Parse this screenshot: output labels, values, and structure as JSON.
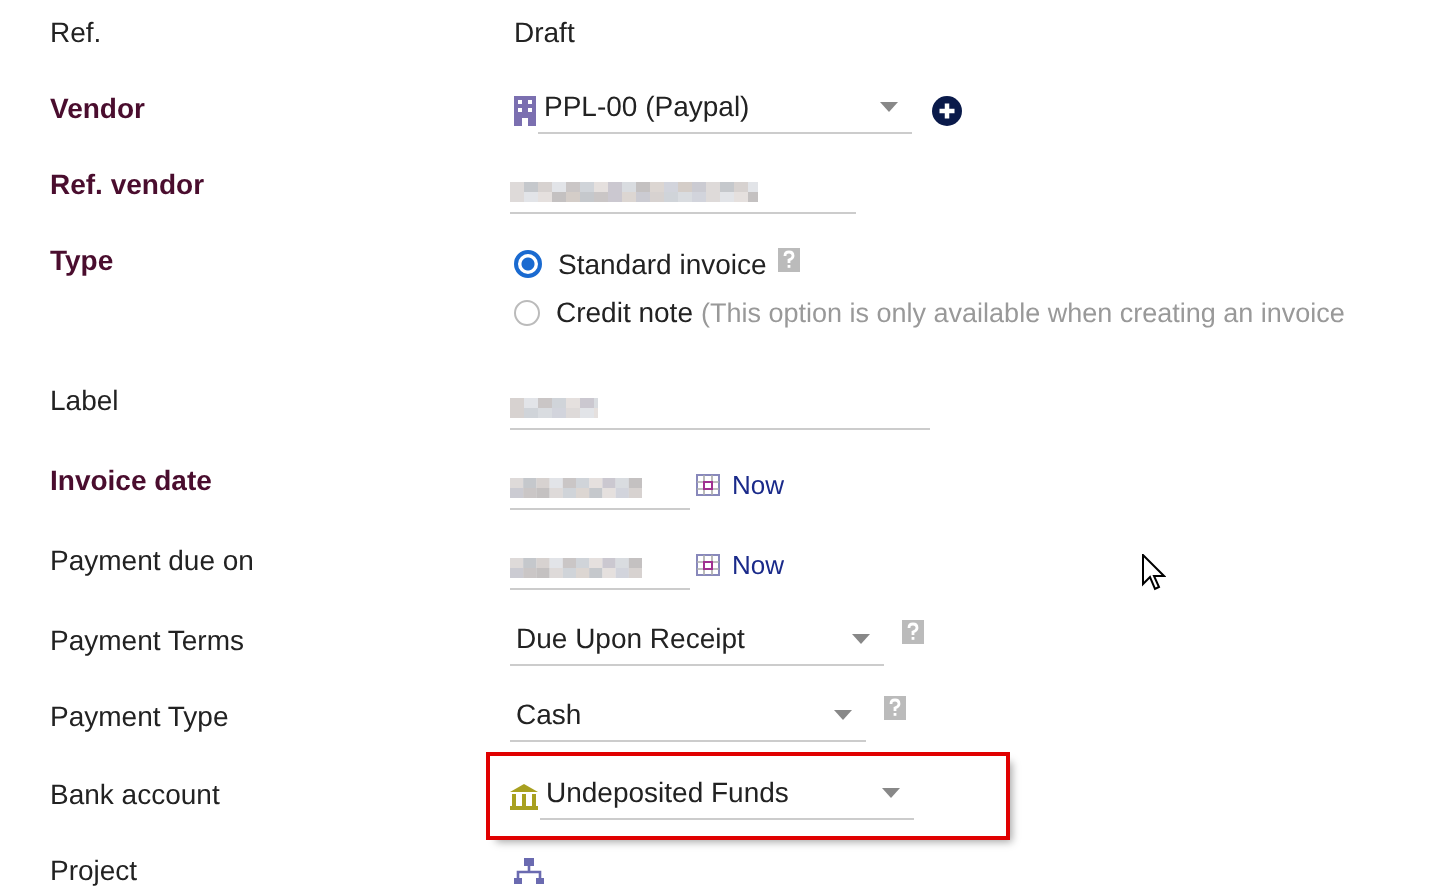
{
  "fields": [
    {
      "label": "Ref.",
      "required": false,
      "kind": "text",
      "value": "Draft"
    },
    {
      "label": "Vendor",
      "required": true,
      "kind": "vendor-select",
      "value": "PPL-00 (Paypal)"
    },
    {
      "label": "Ref. vendor",
      "required": true,
      "kind": "redacted"
    },
    {
      "label": "Type",
      "required": true,
      "kind": "radio",
      "options": [
        {
          "label": "Standard invoice",
          "selected": true,
          "help": true
        },
        {
          "label": "Credit note",
          "note": "(This option is only available when creating an invoice",
          "selected": false,
          "help": false
        }
      ]
    },
    {
      "label": "Label",
      "required": false,
      "kind": "redacted-short"
    },
    {
      "label": "Invoice date",
      "required": true,
      "kind": "date",
      "link": "Now"
    },
    {
      "label": "Payment due on",
      "required": false,
      "kind": "date",
      "link": "Now"
    },
    {
      "label": "Payment Terms",
      "required": false,
      "kind": "select",
      "value": "Due Upon Receipt",
      "help": true
    },
    {
      "label": "Payment Type",
      "required": false,
      "kind": "select",
      "value": "Cash",
      "help": true
    },
    {
      "label": "Bank account",
      "required": false,
      "kind": "bank-select",
      "value": "Undeposited Funds",
      "highlighted": true
    },
    {
      "label": "Project",
      "required": false,
      "kind": "project"
    }
  ]
}
